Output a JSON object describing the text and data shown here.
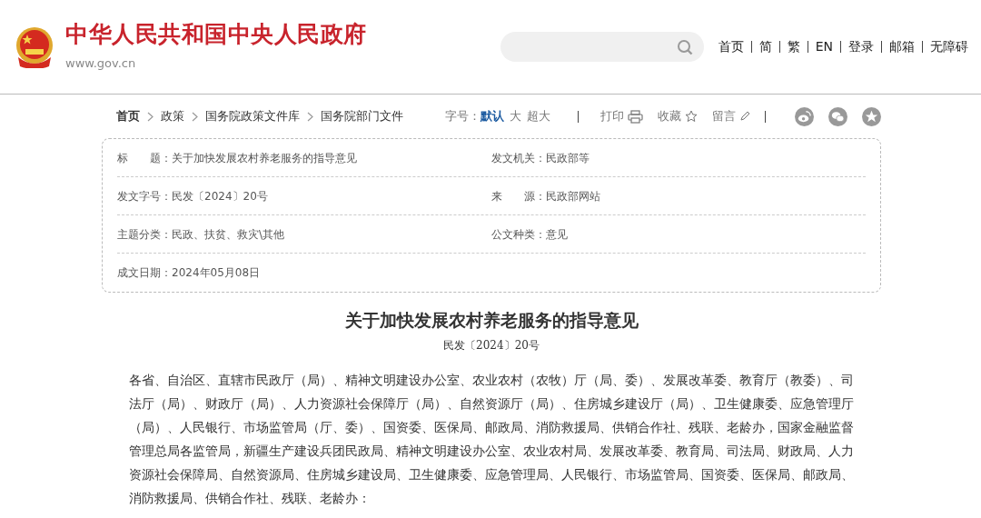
{
  "header": {
    "site_title": "中华人民共和国中央人民政府",
    "domain": "www.gov.cn",
    "top_links": [
      "首页",
      "简",
      "繁",
      "EN",
      "登录",
      "邮箱",
      "无障碍"
    ]
  },
  "breadcrumb": [
    "首页",
    "政策",
    "国务院政策文件库",
    "国务院部门文件"
  ],
  "font_size": {
    "label": "字号：",
    "options": [
      {
        "label": "默认",
        "selected": true
      },
      {
        "label": "大",
        "selected": false
      },
      {
        "label": "超大",
        "selected": false
      }
    ]
  },
  "tools": [
    {
      "label": "打印",
      "kind": "print"
    },
    {
      "label": "收藏",
      "kind": "favorite"
    },
    {
      "label": "留言",
      "kind": "comment"
    }
  ],
  "info_rows": [
    [
      {
        "label": "标　　题：",
        "value": "关于加快发展农村养老服务的指导意见"
      },
      {
        "label": "发文机关：",
        "value": "民政部等"
      }
    ],
    [
      {
        "label": "发文字号：",
        "value": "民发〔2024〕20号"
      },
      {
        "label": "来　　源：",
        "value": "民政部网站"
      }
    ],
    [
      {
        "label": "主题分类：",
        "value": "民政、扶贫、救灾\\其他"
      },
      {
        "label": "公文种类：",
        "value": "意见"
      }
    ],
    [
      {
        "label": "成文日期：",
        "value": "2024年05月08日"
      }
    ]
  ],
  "document": {
    "title": "关于加快发展农村养老服务的指导意见",
    "number": "民发〔2024〕20号",
    "paragraph": "各省、自治区、直辖市民政厅（局）、精神文明建设办公室、农业农村（农牧）厅（局、委）、发展改革委、教育厅（教委）、司法厅（局）、财政厅（局）、人力资源社会保障厅（局）、自然资源厅（局）、住房城乡建设厅（局）、卫生健康委、应急管理厅（局）、人民银行、市场监管局（厅、委）、国资委、医保局、邮政局、消防救援局、供销合作社、残联、老龄办，国家金融监督管理总局各监管局，新疆生产建设兵团民政局、精神文明建设办公室、农业农村局、发展改革委、教育局、司法局、财政局、人力资源社会保障局、自然资源局、住房城乡建设局、卫生健康委、应急管理局、人民银行、市场监管局、国资委、医保局、邮政局、消防救援局、供销合作社、残联、老龄办："
  }
}
